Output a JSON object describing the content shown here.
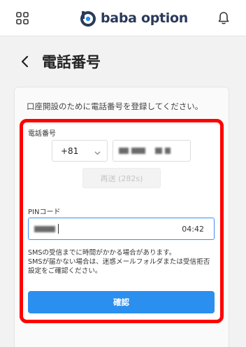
{
  "header": {
    "logo_text": "baba option",
    "menu_icon": "grid-icon",
    "bell_icon": "bell-icon",
    "brand_color": "#2a3a5a"
  },
  "page": {
    "title": "電話番号",
    "back_icon": "chevron-left-icon"
  },
  "form": {
    "intro": "口座開設のために電話番号を登録してください。",
    "phone_label": "電話番号",
    "country_code": "+81",
    "resend_label": "再送 (282s)",
    "pin_label": "PINコード",
    "pin_timer": "04:42",
    "notice_lines": [
      "SMSの受信までに時間がかかる場合があります。",
      "SMSが届かない場合は、迷惑メールフォルダまたは受信拒否",
      "設定をご確認ください。"
    ],
    "confirm_label": "確認"
  },
  "colors": {
    "highlight": "#ff0000",
    "primary": "#2b8ff0",
    "input_focus": "#3d8ef5"
  }
}
